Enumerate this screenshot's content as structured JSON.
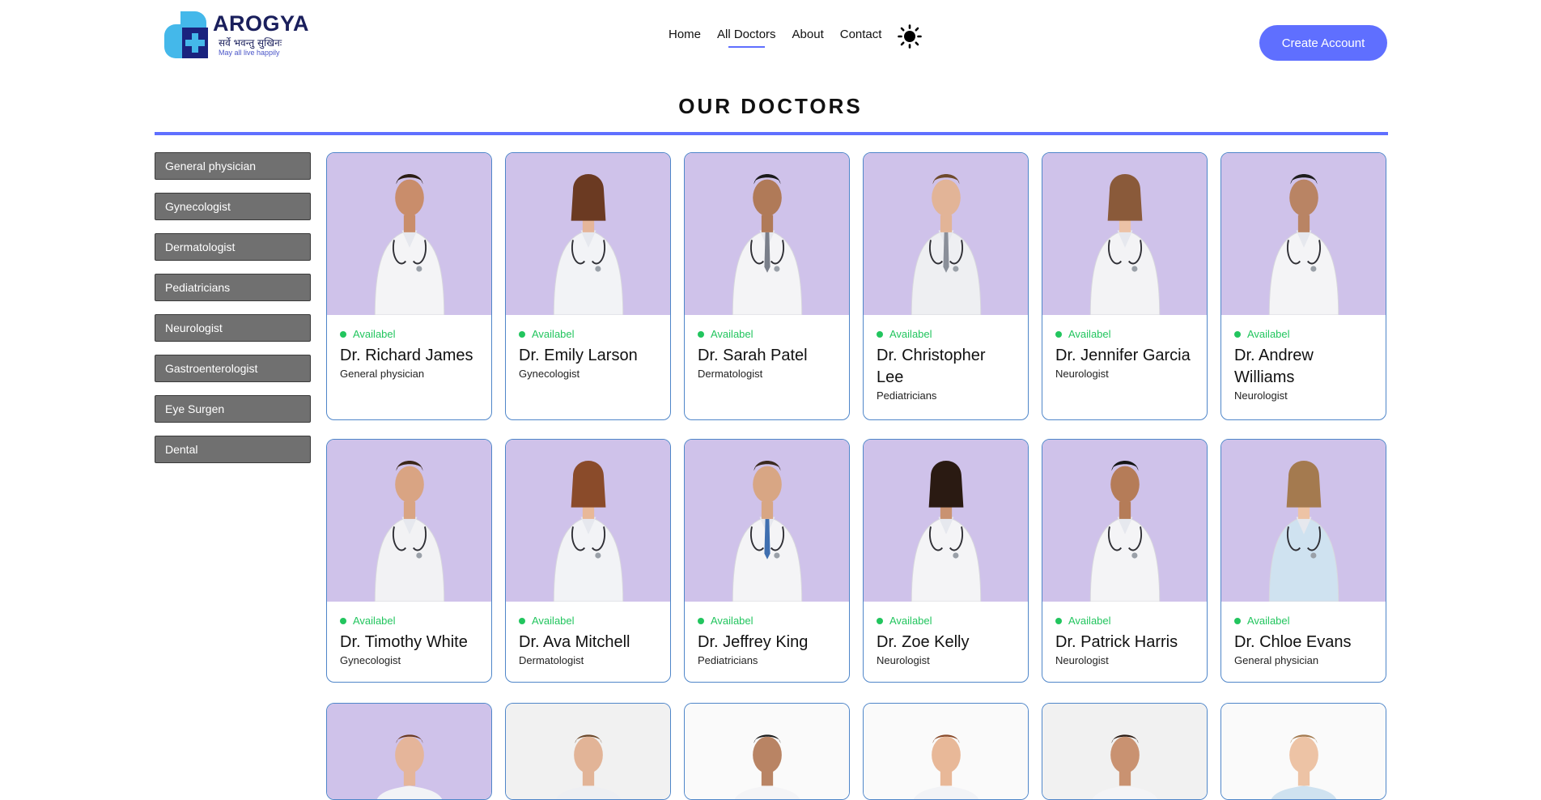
{
  "brand": {
    "name": "AROGYA",
    "sanskrit": "सर्वे भवन्तु सुखिनः",
    "tagline": "May all live happily"
  },
  "nav": {
    "items": [
      "Home",
      "All Doctors",
      "About",
      "Contact"
    ],
    "active": "All Doctors"
  },
  "header": {
    "create_account": "Create Account"
  },
  "page": {
    "title": "OUR DOCTORS"
  },
  "filters": [
    "General physician",
    "Gynecologist",
    "Dermatologist",
    "Pediatricians",
    "Neurologist",
    "Gastroenterologist",
    "Eye Surgen",
    "Dental"
  ],
  "availability_label": "Availabel",
  "doctors": [
    {
      "name": "Dr. Richard James",
      "speciality": "General physician"
    },
    {
      "name": "Dr. Emily Larson",
      "speciality": "Gynecologist"
    },
    {
      "name": "Dr. Sarah Patel",
      "speciality": "Dermatologist"
    },
    {
      "name": "Dr. Christopher Lee",
      "speciality": "Pediatricians"
    },
    {
      "name": "Dr. Jennifer Garcia",
      "speciality": "Neurologist"
    },
    {
      "name": "Dr. Andrew Williams",
      "speciality": "Neurologist"
    },
    {
      "name": "Dr. Timothy White",
      "speciality": "Gynecologist"
    },
    {
      "name": "Dr. Ava Mitchell",
      "speciality": "Dermatologist"
    },
    {
      "name": "Dr. Jeffrey King",
      "speciality": "Pediatricians"
    },
    {
      "name": "Dr. Zoe Kelly",
      "speciality": "Neurologist"
    },
    {
      "name": "Dr. Patrick Harris",
      "speciality": "Neurologist"
    },
    {
      "name": "Dr. Chloe Evans",
      "speciality": "General physician"
    }
  ],
  "colors": {
    "accent": "#5f6fff",
    "available": "#22c55e",
    "photo_bg": "#cfc2ea",
    "filter_bg": "#707070"
  },
  "icons": {
    "theme": "sun-icon",
    "status": "status-dot-icon",
    "doctor": "doctor-photo"
  }
}
